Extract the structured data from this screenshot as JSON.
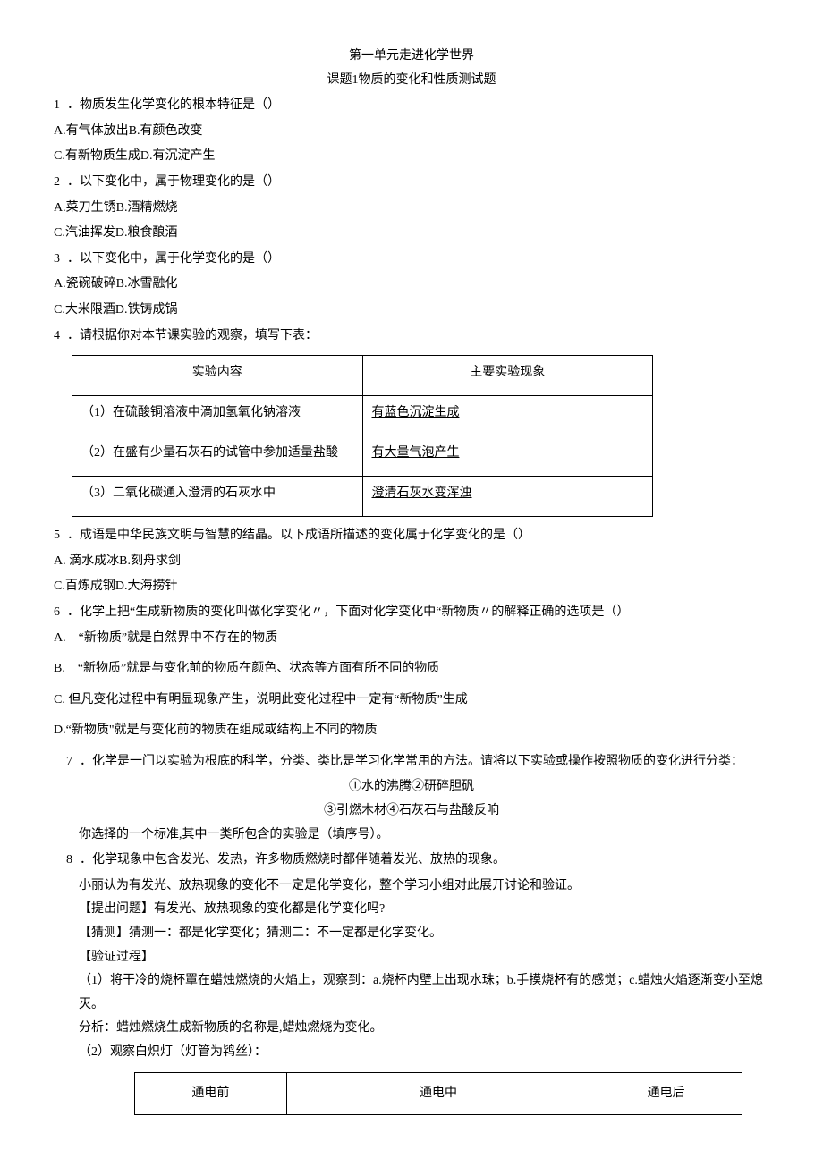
{
  "title1": "第一单元走进化学世界",
  "title2": "课题1物质的变化和性质测试题",
  "q1": {
    "num": "1",
    "text": "．物质发生化学变化的根本特征是（）",
    "a": "A.有气体放出B.有颜色改变",
    "c": "C.有新物质生成D.有沉淀产生"
  },
  "q2": {
    "num": "2",
    "text": "．以下变化中，属于物理变化的是（）",
    "a": "A.菜刀生锈B.酒精燃烧",
    "c": "C.汽油挥发D.粮食酿酒"
  },
  "q3": {
    "num": "3",
    "text": "．以下变化中，属于化学变化的是（）",
    "a": "A.瓷碗破碎B.冰雪融化",
    "c": "C.大米限酒D.铁铸成锅"
  },
  "q4": {
    "num": "4",
    "text": "．请根据你对本节课实验的观察，填写下表：",
    "th1": "实验内容",
    "th2": "主要实验现象",
    "r1c1": "（1）在硫酸铜溶液中滴加氢氧化钠溶液",
    "r1c2": "有蓝色沉淀生成",
    "r2c1": "（2）在盛有少量石灰石的试管中参加适量盐酸",
    "r2c2": "有大量气泡产生",
    "r3c1": "（3）二氧化碳通入澄清的石灰水中",
    "r3c2": "澄清石灰水变浑浊"
  },
  "q5": {
    "num": "5",
    "text": "．成语是中华民族文明与智慧的结晶。以下成语所描述的变化属于化学变化的是（）",
    "a": "A. 滴水成冰B.刻舟求剑",
    "c": "C.百炼成钢D.大海捞针"
  },
  "q6": {
    "num": "6",
    "text": "．化学上把“生成新物质的变化叫做化学变化〃，下面对化学变化中“新物质〃的解释正确的选项是（）",
    "a": "A.　“新物质”就是自然界中不存在的物质",
    "b": "B.　“新物质”就是与变化前的物质在颜色、状态等方面有所不同的物质",
    "c": "C. 但凡变化过程中有明显现象产生，说明此变化过程中一定有“新物质”生成",
    "d": "D.“新物质\"就是与变化前的物质在组成或结构上不同的物质"
  },
  "q7": {
    "num": "7",
    "text": "．化学是一门以实验为根底的科学，分类、类比是学习化学常用的方法。请将以下实验或操作按照物质的变化进行分类：",
    "line1": "①水的沸腾②研碎胆矾",
    "line2": "③引燃木材④石灰石与盐酸反响",
    "line3": "你选择的一个标准,其中一类所包含的实验是（填序号）。"
  },
  "q8": {
    "num": "8",
    "text": "．化学现象中包含发光、发热，许多物质燃烧时都伴随着发光、放热的现象。",
    "p1": "小丽认为有发光、放热现象的变化不一定是化学变化，整个学习小组对此展开讨论和验证。",
    "p2": "【提出问题】有发光、放热现象的变化都是化学变化吗?",
    "p3": "【猜测】猜测一：都是化学变化；猜测二：不一定都是化学变化。",
    "p4": "【验证过程】",
    "p5": "（1）将干冷的烧杯罩在蜡烛燃烧的火焰上，观察到：a.烧杯内壁上出现水珠；b.手摸烧杯有的感觉；c.蜡烛火焰逐渐变小至熄灭。",
    "p6": "分析：蜡烛燃烧生成新物质的名称是,蜡烛燃烧为变化。",
    "p7": "（2）观察白炽灯（灯管为鸨丝）：",
    "th1": "通电前",
    "th2": "通电中",
    "th3": "通电后"
  }
}
